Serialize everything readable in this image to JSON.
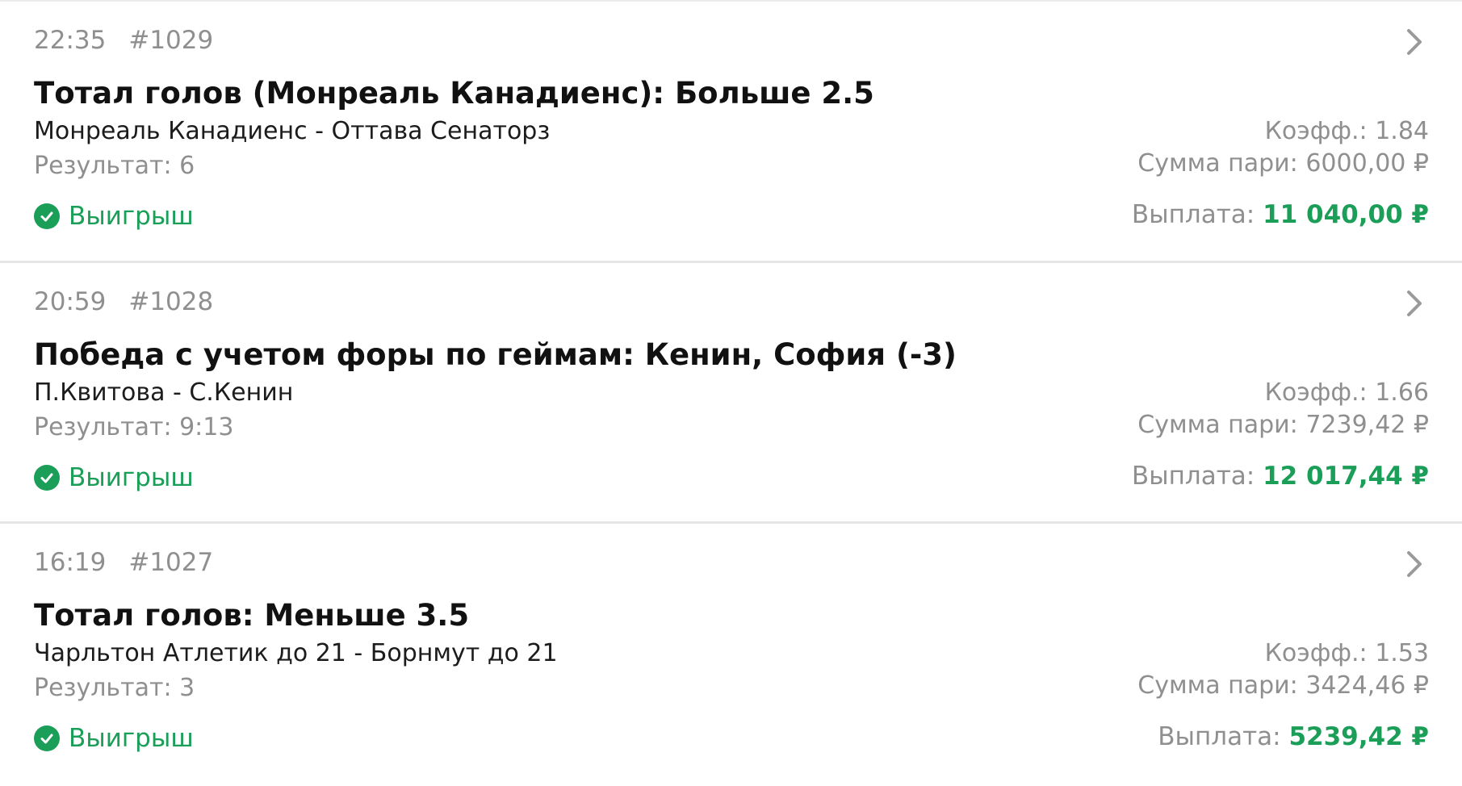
{
  "bets": [
    {
      "time": "22:35",
      "number": "#1029",
      "title": "Тотал голов (Монреаль Канадиенс): Больше 2.5",
      "match": "Монреаль Канадиенс - Оттава Сенаторз",
      "result": "Результат: 6",
      "status": "Выигрыш",
      "coef": "Коэфф.: 1.84",
      "stake": "Сумма пари: 6000,00 ₽",
      "payout_label": "Выплата: ",
      "payout_amount": "11 040,00 ₽"
    },
    {
      "time": "20:59",
      "number": "#1028",
      "title": "Победа с учетом форы по геймам: Кенин, София (-3)",
      "match": "П.Квитова - С.Кенин",
      "result": "Результат: 9:13",
      "status": "Выигрыш",
      "coef": "Коэфф.: 1.66",
      "stake": "Сумма пари: 7239,42 ₽",
      "payout_label": "Выплата: ",
      "payout_amount": "12 017,44 ₽"
    },
    {
      "time": "16:19",
      "number": "#1027",
      "title": "Тотал голов: Меньше 3.5",
      "match": "Чарльтон Атлетик до 21 - Борнмут до 21",
      "result": "Результат: 3",
      "status": "Выигрыш",
      "coef": "Коэфф.: 1.53",
      "stake": "Сумма пари: 3424,46 ₽",
      "payout_label": "Выплата: ",
      "payout_amount": "5239,42 ₽"
    }
  ],
  "icons": {
    "status": "check-circle-icon",
    "open": "chevron-right-icon"
  },
  "colors": {
    "win_green": "#1a9e58",
    "muted_gray": "#8f8f8f",
    "divider": "#e6e6e6"
  }
}
